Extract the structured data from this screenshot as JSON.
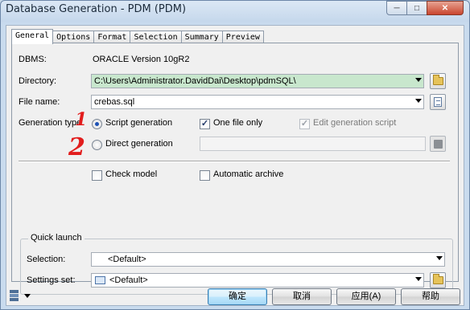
{
  "window": {
    "title": "Database Generation - PDM (PDM)"
  },
  "tabs": [
    {
      "label": "General",
      "active": true
    },
    {
      "label": "Options",
      "active": false
    },
    {
      "label": "Format",
      "active": false
    },
    {
      "label": "Selection",
      "active": false
    },
    {
      "label": "Summary",
      "active": false
    },
    {
      "label": "Preview",
      "active": false
    }
  ],
  "general": {
    "dbms_label": "DBMS:",
    "dbms_value": "ORACLE Version 10gR2",
    "directory_label": "Directory:",
    "directory_value": "C:\\Users\\Administrator.DavidDai\\Desktop\\pdmSQL\\",
    "filename_label": "File name:",
    "filename_value": "crebas.sql",
    "generation_type_label": "Generation type:",
    "script_generation_label": "Script generation",
    "script_generation_selected": true,
    "direct_generation_label": "Direct generation",
    "direct_generation_selected": false,
    "one_file_only_label": "One file only",
    "one_file_only_checked": true,
    "edit_script_label": "Edit generation script",
    "edit_script_checked": true,
    "direct_field_value": "",
    "check_model_label": "Check model",
    "check_model_checked": false,
    "auto_archive_label": "Automatic archive",
    "auto_archive_checked": false,
    "annotation_1": "1",
    "annotation_2": "2"
  },
  "quick_launch": {
    "title": "Quick launch",
    "selection_label": "Selection:",
    "selection_value": "<Default>",
    "settings_label": "Settings set:",
    "settings_value": "<Default>"
  },
  "buttons": {
    "ok": "确定",
    "cancel": "取消",
    "apply": "应用(A)",
    "help": "帮助"
  },
  "colors": {
    "directory_highlight": "#c8e7cd",
    "annotation": "#e21d1d"
  }
}
